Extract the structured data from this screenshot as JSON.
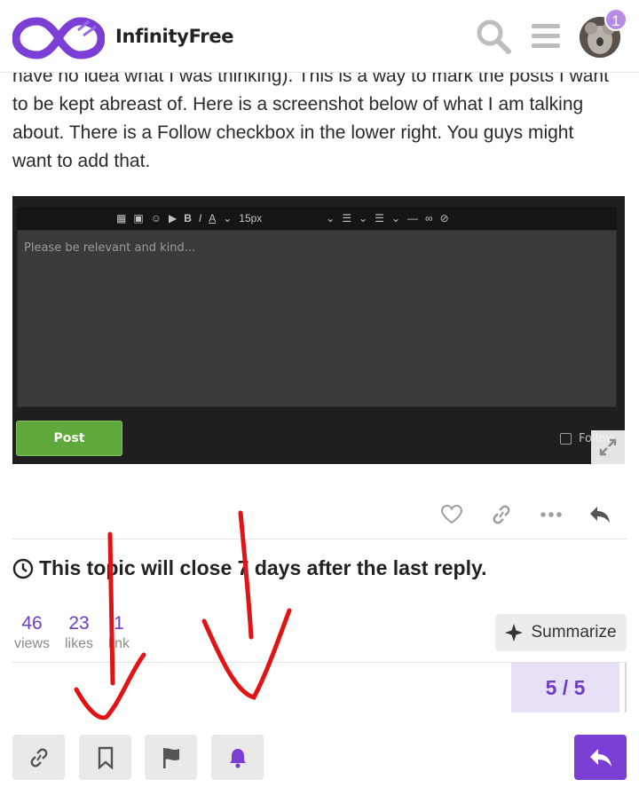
{
  "header": {
    "brand": "InfinityFree",
    "notification_count": "1",
    "icons": {
      "search": "search-icon",
      "menu": "hamburger-menu-icon"
    },
    "brand_color": "#7b3fd6"
  },
  "post": {
    "lines": [
      "have no idea what I was thinking). This is a way to mark the posts I want",
      "to be kept abreast of. Here is a screenshot below of what I am talking",
      "about. There is a Follow checkbox in the lower right. You guys might",
      "want to add that."
    ],
    "image": {
      "font_size_label": "15px",
      "placeholder": "Please be relevant and kind...",
      "post_button": "Post",
      "follow_label": "Follow"
    }
  },
  "post_actions": {
    "icons": [
      "like-icon",
      "copy-link-icon",
      "more-icon",
      "reply-icon"
    ]
  },
  "topic": {
    "close_notice": "This topic will close 7 days after the last reply."
  },
  "stats": [
    {
      "num": "46",
      "label": "views"
    },
    {
      "num": "23",
      "label": "likes"
    },
    {
      "num": "1",
      "label": "link"
    }
  ],
  "summarize": {
    "label": "Summarize"
  },
  "timeline": {
    "progress": "5 / 5"
  },
  "footer_buttons": [
    "copy-link-icon",
    "bookmark-icon",
    "flag-icon",
    "bell-icon",
    "reply-icon"
  ],
  "colors": {
    "accent": "#6d3fc0",
    "annotation_red": "#e01414"
  }
}
